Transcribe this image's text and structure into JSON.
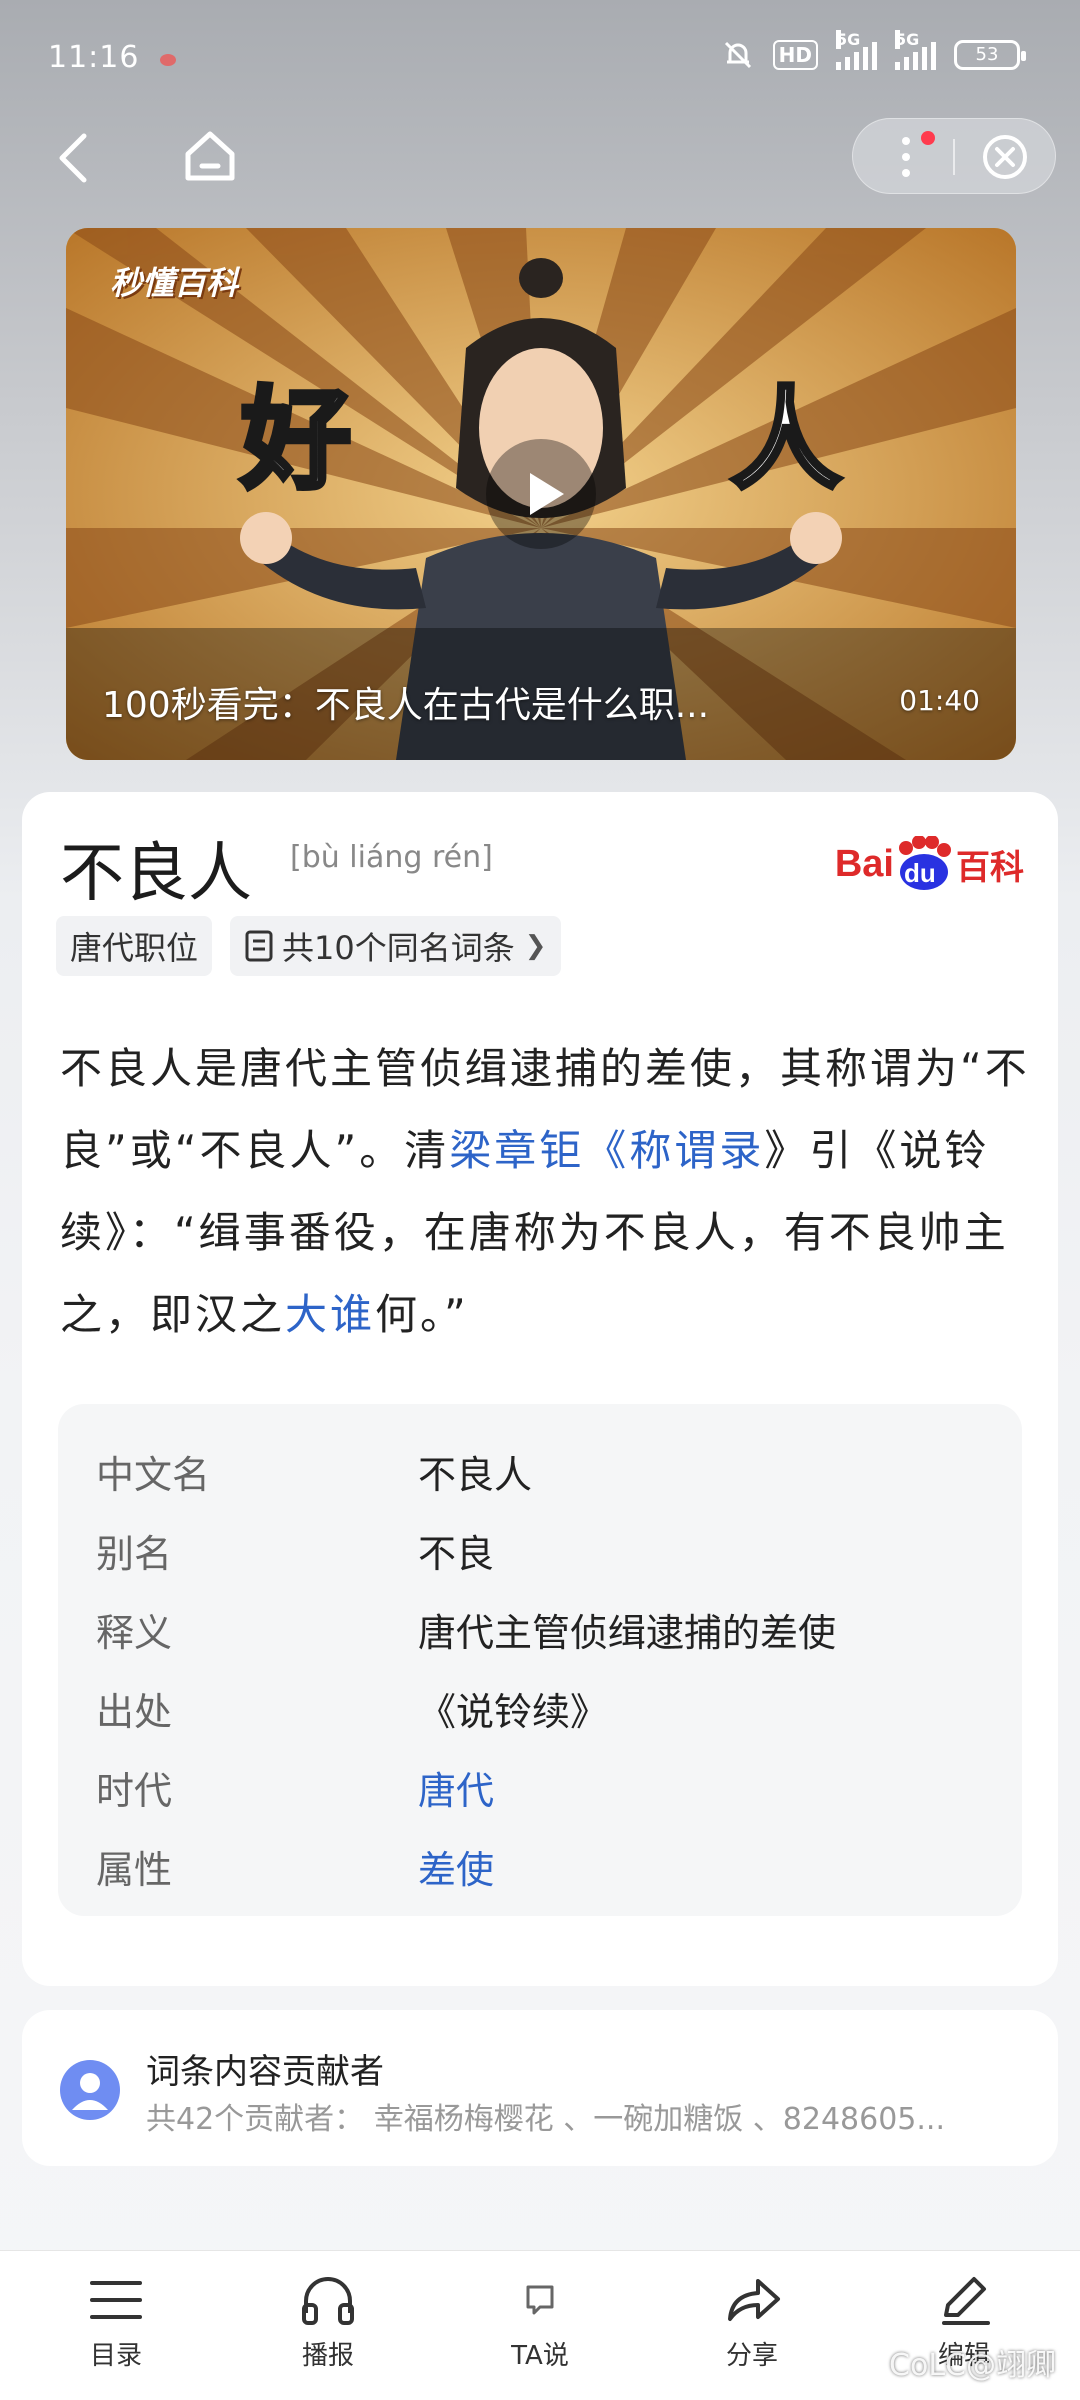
{
  "status_bar": {
    "time": "11:16",
    "network1": "5G",
    "network2": "5G",
    "hd": "HD",
    "battery": "53"
  },
  "video": {
    "title": "100秒看完：不良人在古代是什么职...",
    "duration": "01:40",
    "logo": "秒懂百科",
    "left_char": "好",
    "right_char": "人"
  },
  "entry": {
    "title": "不良人",
    "pinyin": "[bù liáng rén]",
    "logo_text_a": "Bai",
    "logo_text_b": "du",
    "logo_text_c": "百科",
    "tags": [
      "唐代职位",
      "共10个同名词条"
    ],
    "summary": {
      "p1": "不良人是唐代主管侦缉逮捕的差使，其称谓为“不良”或“不良人”。清",
      "l1": "梁章钜",
      "p2": "《",
      "l2": "称谓录",
      "p3": "》引《说铃续》：“缉事番役，在唐称为不良人，有不良帅主之，即汉之",
      "l3": "大谁",
      "p4": "何。”"
    },
    "infobox": [
      {
        "key": "中文名",
        "value": "不良人"
      },
      {
        "key": "别名",
        "value": "不良"
      },
      {
        "key": "释义",
        "value": "唐代主管侦缉逮捕的差使"
      },
      {
        "key": "出处",
        "value": "《说铃续》"
      },
      {
        "key": "时代",
        "value": "唐代"
      },
      {
        "key": "属性",
        "value": "差使"
      }
    ]
  },
  "contributors": {
    "title": "词条内容贡献者",
    "subtitle": "共42个贡献者：  幸福杨梅樱花 、一碗加糖饭 、8248605..."
  },
  "bottom_bar": {
    "items": [
      "目录",
      "播报",
      "TA说",
      "分享",
      "编辑"
    ]
  },
  "watermark": "CoLC@翊卿",
  "colors": {
    "link": "#2d64c8",
    "baidu_red": "#de2a2a",
    "baidu_blue": "#2932e1"
  }
}
